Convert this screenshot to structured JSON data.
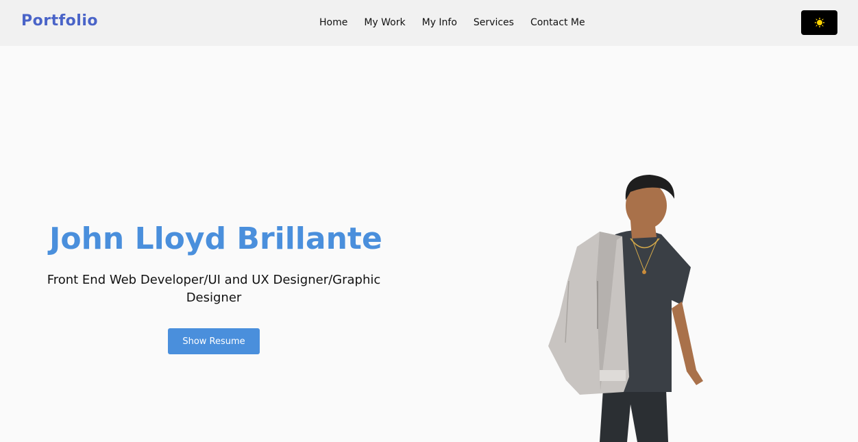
{
  "header": {
    "brand": "Portfolio",
    "nav": [
      "Home",
      "My Work",
      "My Info",
      "Services",
      "Contact Me"
    ],
    "theme_toggle_icon": "sun-icon"
  },
  "hero": {
    "name": "John Lloyd Brillante",
    "role": "Front End Web Developer/UI and UX Designer/Graphic Designer",
    "resume_button": "Show Resume",
    "portrait_icon": "person-photo"
  },
  "colors": {
    "brand": "#4a64c8",
    "accent": "#4a8fdc",
    "toggle_bg": "#000000",
    "sun": "#ffd400"
  }
}
